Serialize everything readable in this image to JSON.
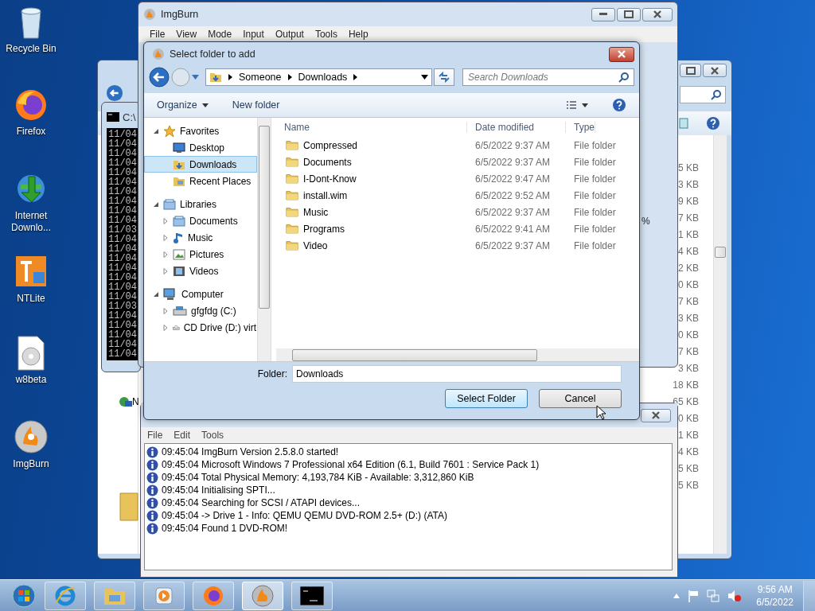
{
  "desktop_icons": [
    {
      "label": "Recycle Bin",
      "kind": "bin"
    },
    {
      "label": "Firefox",
      "kind": "firefox"
    },
    {
      "label": "Internet Downlo...",
      "kind": "download"
    },
    {
      "label": "NTLite",
      "kind": "ntlite"
    },
    {
      "label": "w8beta",
      "kind": "disc"
    },
    {
      "label": "ImgBurn",
      "kind": "imgburn"
    }
  ],
  "explorer_window": {
    "peek_label": "N",
    "size_rows": [
      {
        "size": "5 KB"
      },
      {
        "size": "3 KB"
      },
      {
        "size": "9 KB"
      },
      {
        "size": "7 KB"
      },
      {
        "size": "1 KB"
      },
      {
        "size": "4 KB"
      },
      {
        "size": "2 KB"
      },
      {
        "size": "0 KB"
      },
      {
        "size": "7 KB"
      },
      {
        "size": "3 KB"
      },
      {
        "size": "0 KB"
      },
      {
        "size": "7 KB"
      },
      {
        "size": "3 KB"
      },
      {
        "size": "18 KB"
      },
      {
        "size": "65 KB"
      },
      {
        "size": "0 KB"
      },
      {
        "size": "1 KB"
      },
      {
        "size": "4 KB"
      },
      {
        "size": "5 KB"
      },
      {
        "size": "5 KB"
      }
    ]
  },
  "console_window": {
    "title": "C:\\",
    "lines": [
      "11/04",
      "11/04",
      "11/04",
      "11/04",
      "11/04",
      "11/04",
      "11/04",
      "11/04",
      "11/04",
      "11/04",
      "11/03",
      "11/04",
      "11/04",
      "11/04",
      "11/04",
      "11/04",
      "11/04",
      "11/04",
      "11/03",
      "11/04",
      "11/04",
      "11/04",
      "11/04",
      "11/04"
    ]
  },
  "imgburn_window": {
    "title": "ImgBurn",
    "percent_text": "%",
    "menu": [
      "File",
      "View",
      "Mode",
      "Input",
      "Output",
      "Tools",
      "Help"
    ]
  },
  "log_window": {
    "menu": [
      "File",
      "Edit",
      "Tools"
    ],
    "lines": [
      "09:45:04 ImgBurn Version 2.5.8.0 started!",
      "09:45:04 Microsoft Windows 7 Professional x64 Edition (6.1, Build 7601 : Service Pack 1)",
      "09:45:04 Total Physical Memory: 4,193,784 KiB  -  Available: 3,312,860 KiB",
      "09:45:04 Initialising SPTI...",
      "09:45:04 Searching for SCSI / ATAPI devices...",
      "09:45:04 -> Drive 1 - Info: QEMU QEMU DVD-ROM 2.5+ (D:) (ATA)",
      "09:45:04 Found 1 DVD-ROM!"
    ]
  },
  "dialog": {
    "title": "Select folder to add",
    "breadcrumb": [
      "Someone",
      "Downloads"
    ],
    "search": {
      "placeholder": "Search Downloads"
    },
    "toolbar": [
      "Organize",
      "New folder"
    ],
    "nav_tree": [
      {
        "label": "Favorites",
        "kind": "favorites",
        "expanded": true,
        "selected": false,
        "children": [
          {
            "label": "Desktop",
            "kind": "desktop",
            "selected": false
          },
          {
            "label": "Downloads",
            "kind": "downloads",
            "selected": true
          },
          {
            "label": "Recent Places",
            "kind": "recent",
            "selected": false
          }
        ]
      },
      {
        "label": "Libraries",
        "kind": "libraries",
        "expanded": true,
        "selected": false,
        "children": [
          {
            "label": "Documents",
            "kind": "documents",
            "expanded": false,
            "selected": false
          },
          {
            "label": "Music",
            "kind": "music",
            "expanded": false,
            "selected": false
          },
          {
            "label": "Pictures",
            "kind": "pictures",
            "expanded": false,
            "selected": false
          },
          {
            "label": "Videos",
            "kind": "videos",
            "expanded": false,
            "selected": false
          }
        ]
      },
      {
        "label": "Computer",
        "kind": "computer",
        "expanded": true,
        "selected": false,
        "children": [
          {
            "label": "gfgfdg (C:)",
            "kind": "drive",
            "expanded": false,
            "selected": false
          },
          {
            "label": "CD Drive (D:) virt",
            "kind": "cd",
            "expanded": false,
            "selected": false
          }
        ]
      }
    ],
    "columns": [
      "Name",
      "Date modified",
      "Type"
    ],
    "files": [
      {
        "name": "Compressed",
        "date": "6/5/2022 9:37 AM",
        "type": "File folder"
      },
      {
        "name": "Documents",
        "date": "6/5/2022 9:37 AM",
        "type": "File folder"
      },
      {
        "name": "I-Dont-Know",
        "date": "6/5/2022 9:47 AM",
        "type": "File folder"
      },
      {
        "name": "install.wim",
        "date": "6/5/2022 9:52 AM",
        "type": "File folder"
      },
      {
        "name": "Music",
        "date": "6/5/2022 9:37 AM",
        "type": "File folder"
      },
      {
        "name": "Programs",
        "date": "6/5/2022 9:41 AM",
        "type": "File folder"
      },
      {
        "name": "Video",
        "date": "6/5/2022 9:37 AM",
        "type": "File folder"
      }
    ],
    "folder_label": "Folder:",
    "folder_value": "Downloads",
    "buttons": [
      "Select Folder",
      "Cancel"
    ]
  },
  "taskbar": {
    "items": [
      {
        "kind": "ie",
        "selected": false
      },
      {
        "kind": "explorer",
        "selected": false
      },
      {
        "kind": "media",
        "selected": false
      },
      {
        "kind": "firefox",
        "selected": false
      },
      {
        "kind": "imgburn",
        "selected": true
      },
      {
        "kind": "console",
        "selected": false
      }
    ],
    "time": "9:56 AM",
    "date": "6/5/2022"
  }
}
